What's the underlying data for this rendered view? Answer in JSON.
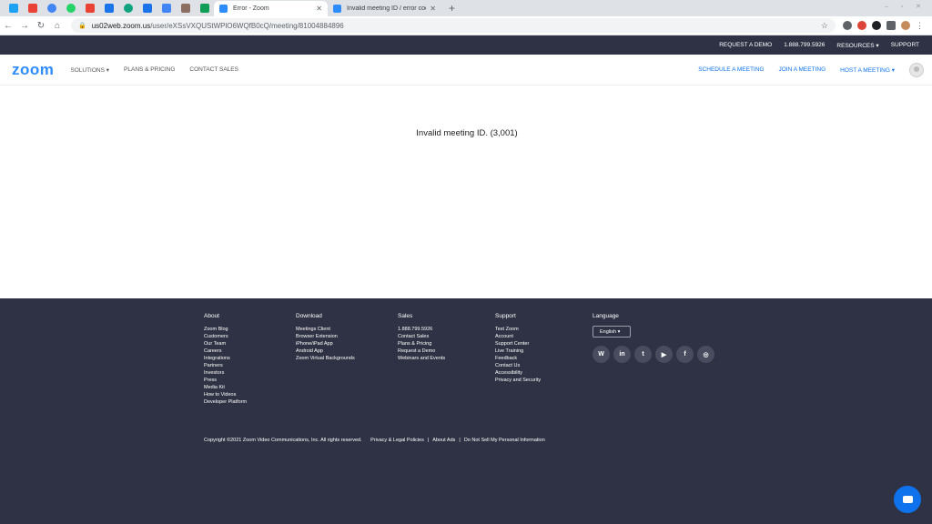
{
  "browser": {
    "pinned_tabs": [
      {
        "icon": "twitter-icon",
        "color": "#1da1f2"
      },
      {
        "icon": "gmail-icon",
        "color": "#ea4335"
      },
      {
        "icon": "chat-icon",
        "color": "#4285f4"
      },
      {
        "icon": "whatsapp-icon",
        "color": "#25d366"
      },
      {
        "icon": "gmail-icon",
        "color": "#ea4335"
      },
      {
        "icon": "calendar-icon",
        "color": "#1a73e8"
      },
      {
        "icon": "chatgpt-icon",
        "color": "#10a37f"
      },
      {
        "icon": "todoist-icon",
        "color": "#1a73e8"
      },
      {
        "icon": "docs-icon",
        "color": "#4285f4"
      },
      {
        "icon": "contacts-icon",
        "color": "#8d6e63"
      },
      {
        "icon": "sheets-icon",
        "color": "#0f9d58"
      }
    ],
    "tabs": [
      {
        "title": "Error - Zoom",
        "active": true
      },
      {
        "title": "Invalid meeting ID / error code",
        "active": false
      }
    ],
    "url_host": "us02web.zoom.us",
    "url_path": "/user/eXSsVXQUStWPlO6WQfB0cQ/meeting/81004884896"
  },
  "topstrip": {
    "request_demo": "REQUEST A DEMO",
    "phone": "1.888.799.5926",
    "resources": "RESOURCES",
    "support": "SUPPORT"
  },
  "header": {
    "logo": "zoom",
    "solutions": "SOLUTIONS",
    "plans": "PLANS & PRICING",
    "contact_sales": "CONTACT SALES",
    "schedule": "SCHEDULE A MEETING",
    "join": "JOIN A MEETING",
    "host": "HOST A MEETING"
  },
  "main": {
    "error_message": "Invalid meeting ID. (3,001)"
  },
  "footer": {
    "about": {
      "title": "About",
      "links": [
        "Zoom Blog",
        "Customers",
        "Our Team",
        "Careers",
        "Integrations",
        "Partners",
        "Investors",
        "Press",
        "Media Kit",
        "How to Videos",
        "Developer Platform"
      ]
    },
    "download": {
      "title": "Download",
      "links": [
        "Meetings Client",
        "Browser Extension",
        "iPhone/iPad App",
        "Android App",
        "Zoom Virtual Backgrounds"
      ]
    },
    "sales": {
      "title": "Sales",
      "links": [
        "1.888.799.5926",
        "Contact Sales",
        "Plans & Pricing",
        "Request a Demo",
        "Webinars and Events"
      ]
    },
    "support": {
      "title": "Support",
      "links": [
        "Test Zoom",
        "Account",
        "Support Center",
        "Live Training",
        "Feedback",
        "Contact Us",
        "Accessibility",
        "Privacy and Security"
      ]
    },
    "language": {
      "title": "Language",
      "selected": "English"
    },
    "social": [
      "wordpress-icon",
      "linkedin-icon",
      "twitter-icon",
      "youtube-icon",
      "facebook-icon",
      "instagram-icon"
    ],
    "copyright": "Copyright ©2021 Zoom Video Communications, Inc. All rights reserved.",
    "privacy": "Privacy & Legal Policies",
    "about_ads": "About Ads",
    "do_not_sell": "Do Not Sell My Personal Information"
  }
}
